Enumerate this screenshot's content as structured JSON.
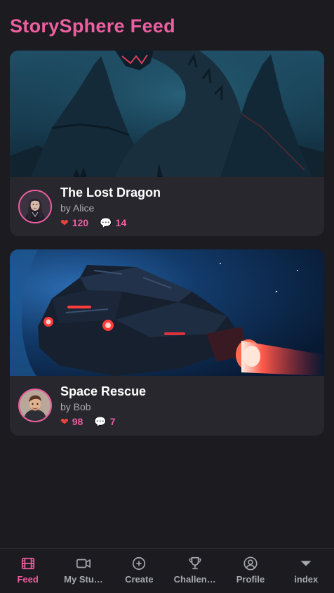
{
  "page": {
    "title": "StorySphere Feed"
  },
  "stories": [
    {
      "title": "The Lost Dragon",
      "author": "by Alice",
      "likes": "120",
      "comments": "14",
      "cover_icon": "dragon-image",
      "avatar_icon": "alice-avatar"
    },
    {
      "title": "Space Rescue",
      "author": "by Bob",
      "likes": "98",
      "comments": "7",
      "cover_icon": "spaceship-image",
      "avatar_icon": "bob-avatar"
    }
  ],
  "nav": {
    "items": [
      {
        "label": "Feed",
        "icon": "film-icon",
        "active": true
      },
      {
        "label": "My Stu…",
        "icon": "video-camera-icon",
        "active": false
      },
      {
        "label": "Create",
        "icon": "plus-circle-icon",
        "active": false
      },
      {
        "label": "Challen…",
        "icon": "trophy-icon",
        "active": false
      },
      {
        "label": "Profile",
        "icon": "user-circle-icon",
        "active": false
      },
      {
        "label": "index",
        "icon": "caret-down-icon",
        "active": false
      }
    ]
  },
  "colors": {
    "accent": "#ec5fa0",
    "background": "#1b1b20",
    "card": "#27272d",
    "heart": "#e8433b"
  }
}
